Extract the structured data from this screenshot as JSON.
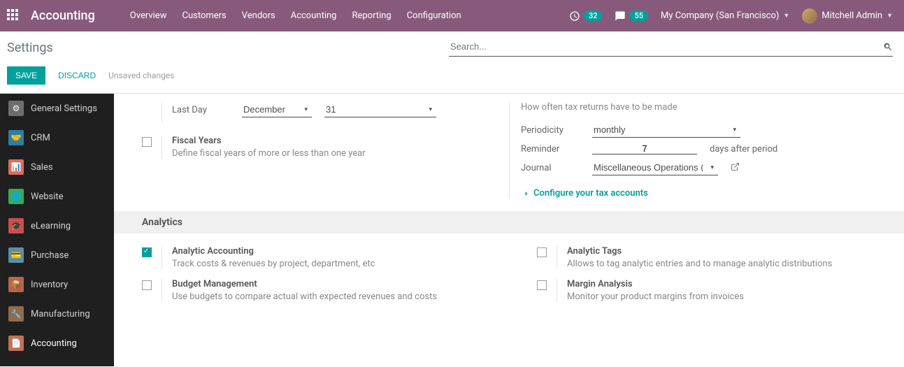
{
  "header": {
    "brand": "Accounting",
    "menu": [
      "Overview",
      "Customers",
      "Vendors",
      "Accounting",
      "Reporting",
      "Configuration"
    ],
    "activity_count": "32",
    "message_count": "55",
    "company": "My Company (San Francisco)",
    "user": "Mitchell Admin"
  },
  "cp": {
    "title": "Settings",
    "search_placeholder": "Search...",
    "save": "SAVE",
    "discard": "DISCARD",
    "unsaved": "Unsaved changes"
  },
  "sidebar": [
    {
      "label": "General Settings",
      "bg": "#6d6d6d"
    },
    {
      "label": "CRM",
      "bg": "#2e7ea5"
    },
    {
      "label": "Sales",
      "bg": "#e16b5a"
    },
    {
      "label": "Website",
      "bg": "#3aaa55"
    },
    {
      "label": "eLearning",
      "bg": "#c94f4f"
    },
    {
      "label": "Purchase",
      "bg": "#5b8fa8"
    },
    {
      "label": "Inventory",
      "bg": "#b5654a"
    },
    {
      "label": "Manufacturing",
      "bg": "#8c6d4f"
    },
    {
      "label": "Accounting",
      "bg": "#c7704f"
    }
  ],
  "fiscal": {
    "last_day_label": "Last Day",
    "month": "December",
    "day": "31",
    "fy_title": "Fiscal Years",
    "fy_desc": "Define fiscal years of more or less than one year"
  },
  "tax": {
    "help": "How often tax returns have to be made",
    "periodicity_label": "Periodicity",
    "periodicity_value": "monthly",
    "reminder_label": "Reminder",
    "reminder_value": "7",
    "reminder_suffix": "days after period",
    "journal_label": "Journal",
    "journal_value": "Miscellaneous Operations (IN",
    "configure": "Configure your tax accounts"
  },
  "sections": {
    "analytics": "Analytics"
  },
  "analytics": {
    "aa_title": "Analytic Accounting",
    "aa_desc": "Track costs & revenues by project, department, etc",
    "at_title": "Analytic Tags",
    "at_desc": "Allows to tag analytic entries and to manage analytic distributions",
    "bm_title": "Budget Management",
    "bm_desc": "Use budgets to compare actual with expected revenues and costs",
    "ma_title": "Margin Analysis",
    "ma_desc": "Monitor your product margins from invoices"
  }
}
